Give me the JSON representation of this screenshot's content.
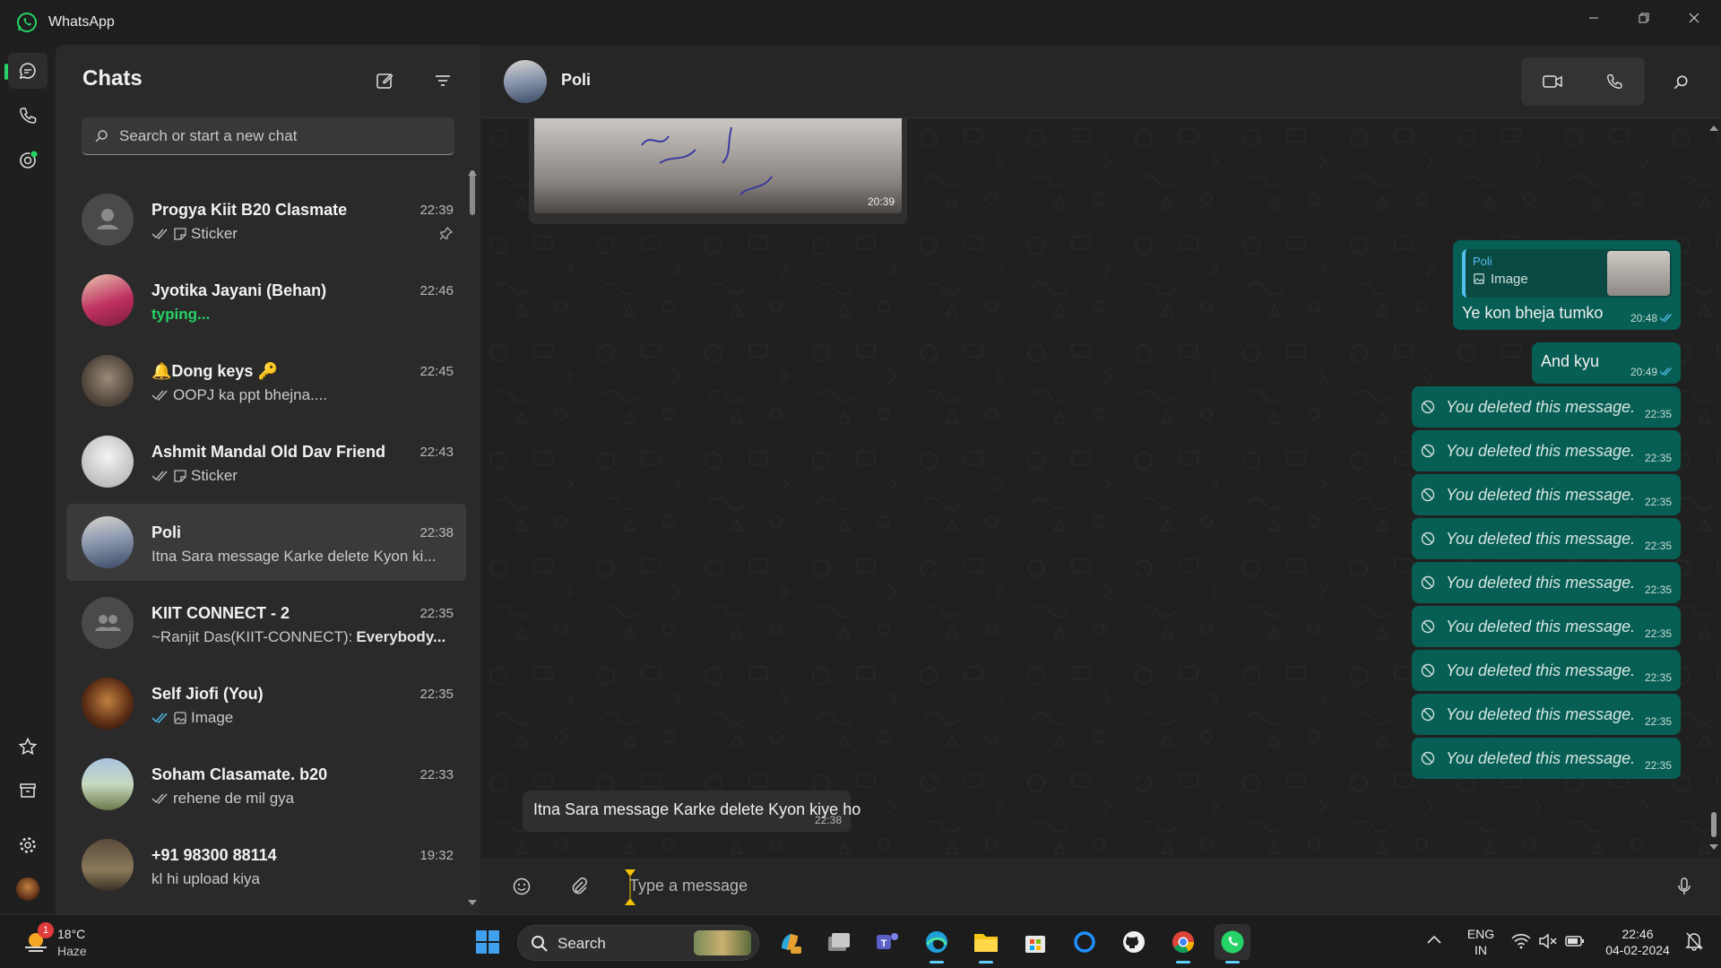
{
  "app": {
    "title": "WhatsApp"
  },
  "colors": {
    "accent": "#25d366",
    "outgoing_bubble": "#075e54",
    "incoming_bubble": "#2f2f2f",
    "read_tick": "#53bdeb"
  },
  "rail": {
    "items": [
      {
        "icon": "chat-icon"
      },
      {
        "icon": "phone-icon"
      },
      {
        "icon": "status-icon"
      },
      {
        "icon": "star-icon"
      },
      {
        "icon": "archive-icon"
      },
      {
        "icon": "settings-gear-icon"
      },
      {
        "icon": "profile-avatar"
      }
    ]
  },
  "sidebar": {
    "title": "Chats",
    "search_placeholder": "Search or start a new chat",
    "chats": [
      {
        "name": "Progya Kiit B20 Clasmate",
        "time": "22:39",
        "preview": "Sticker",
        "pinned": true
      },
      {
        "name": "Jyotika Jayani (Behan)",
        "time": "22:46",
        "preview": "typing..."
      },
      {
        "name": "🔔Dong keys 🔑",
        "time": "22:45",
        "preview": "OOPJ ka ppt bhejna...."
      },
      {
        "name": "Ashmit Mandal Old Dav Friend",
        "time": "22:43",
        "preview": "Sticker"
      },
      {
        "name": "Poli",
        "time": "22:38",
        "preview": "Itna Sara message Karke delete Kyon ki..."
      },
      {
        "name": "KIIT CONNECT - 2",
        "time": "22:35",
        "preview_sender": "~Ranjit Das(KIIT-CONNECT):",
        "preview": "Everybody..."
      },
      {
        "name": "Self Jiofi (You)",
        "time": "22:35",
        "preview": "Image"
      },
      {
        "name": "Soham Clasamate. b20",
        "time": "22:33",
        "preview": "rehene de mil gya"
      },
      {
        "name": "+91 98300 88114",
        "time": "19:32",
        "preview": "kl hi upload kiya"
      }
    ]
  },
  "chat": {
    "contact_name": "Poli",
    "image_message_time": "20:39",
    "reply": {
      "quoted_author": "Poli",
      "quoted_type": "Image",
      "text": "Ye kon bheja tumko",
      "time": "20:48"
    },
    "and_kyu": {
      "text": "And kyu",
      "time": "20:49"
    },
    "deleted_text": "You deleted this message.",
    "deleted_times": [
      "22:35",
      "22:35",
      "22:35",
      "22:35",
      "22:35",
      "22:35",
      "22:35",
      "22:35",
      "22:35"
    ],
    "last_incoming": {
      "text": "Itna Sara message Karke delete Kyon kiye ho",
      "time": "22:38"
    },
    "composer_placeholder": "Type a message"
  },
  "taskbar": {
    "weather_temp": "18°C",
    "weather_desc": "Haze",
    "weather_badge": "1",
    "search_label": "Search",
    "lang_top": "ENG",
    "lang_bottom": "IN",
    "clock_time": "22:46",
    "clock_date": "04-02-2024"
  }
}
